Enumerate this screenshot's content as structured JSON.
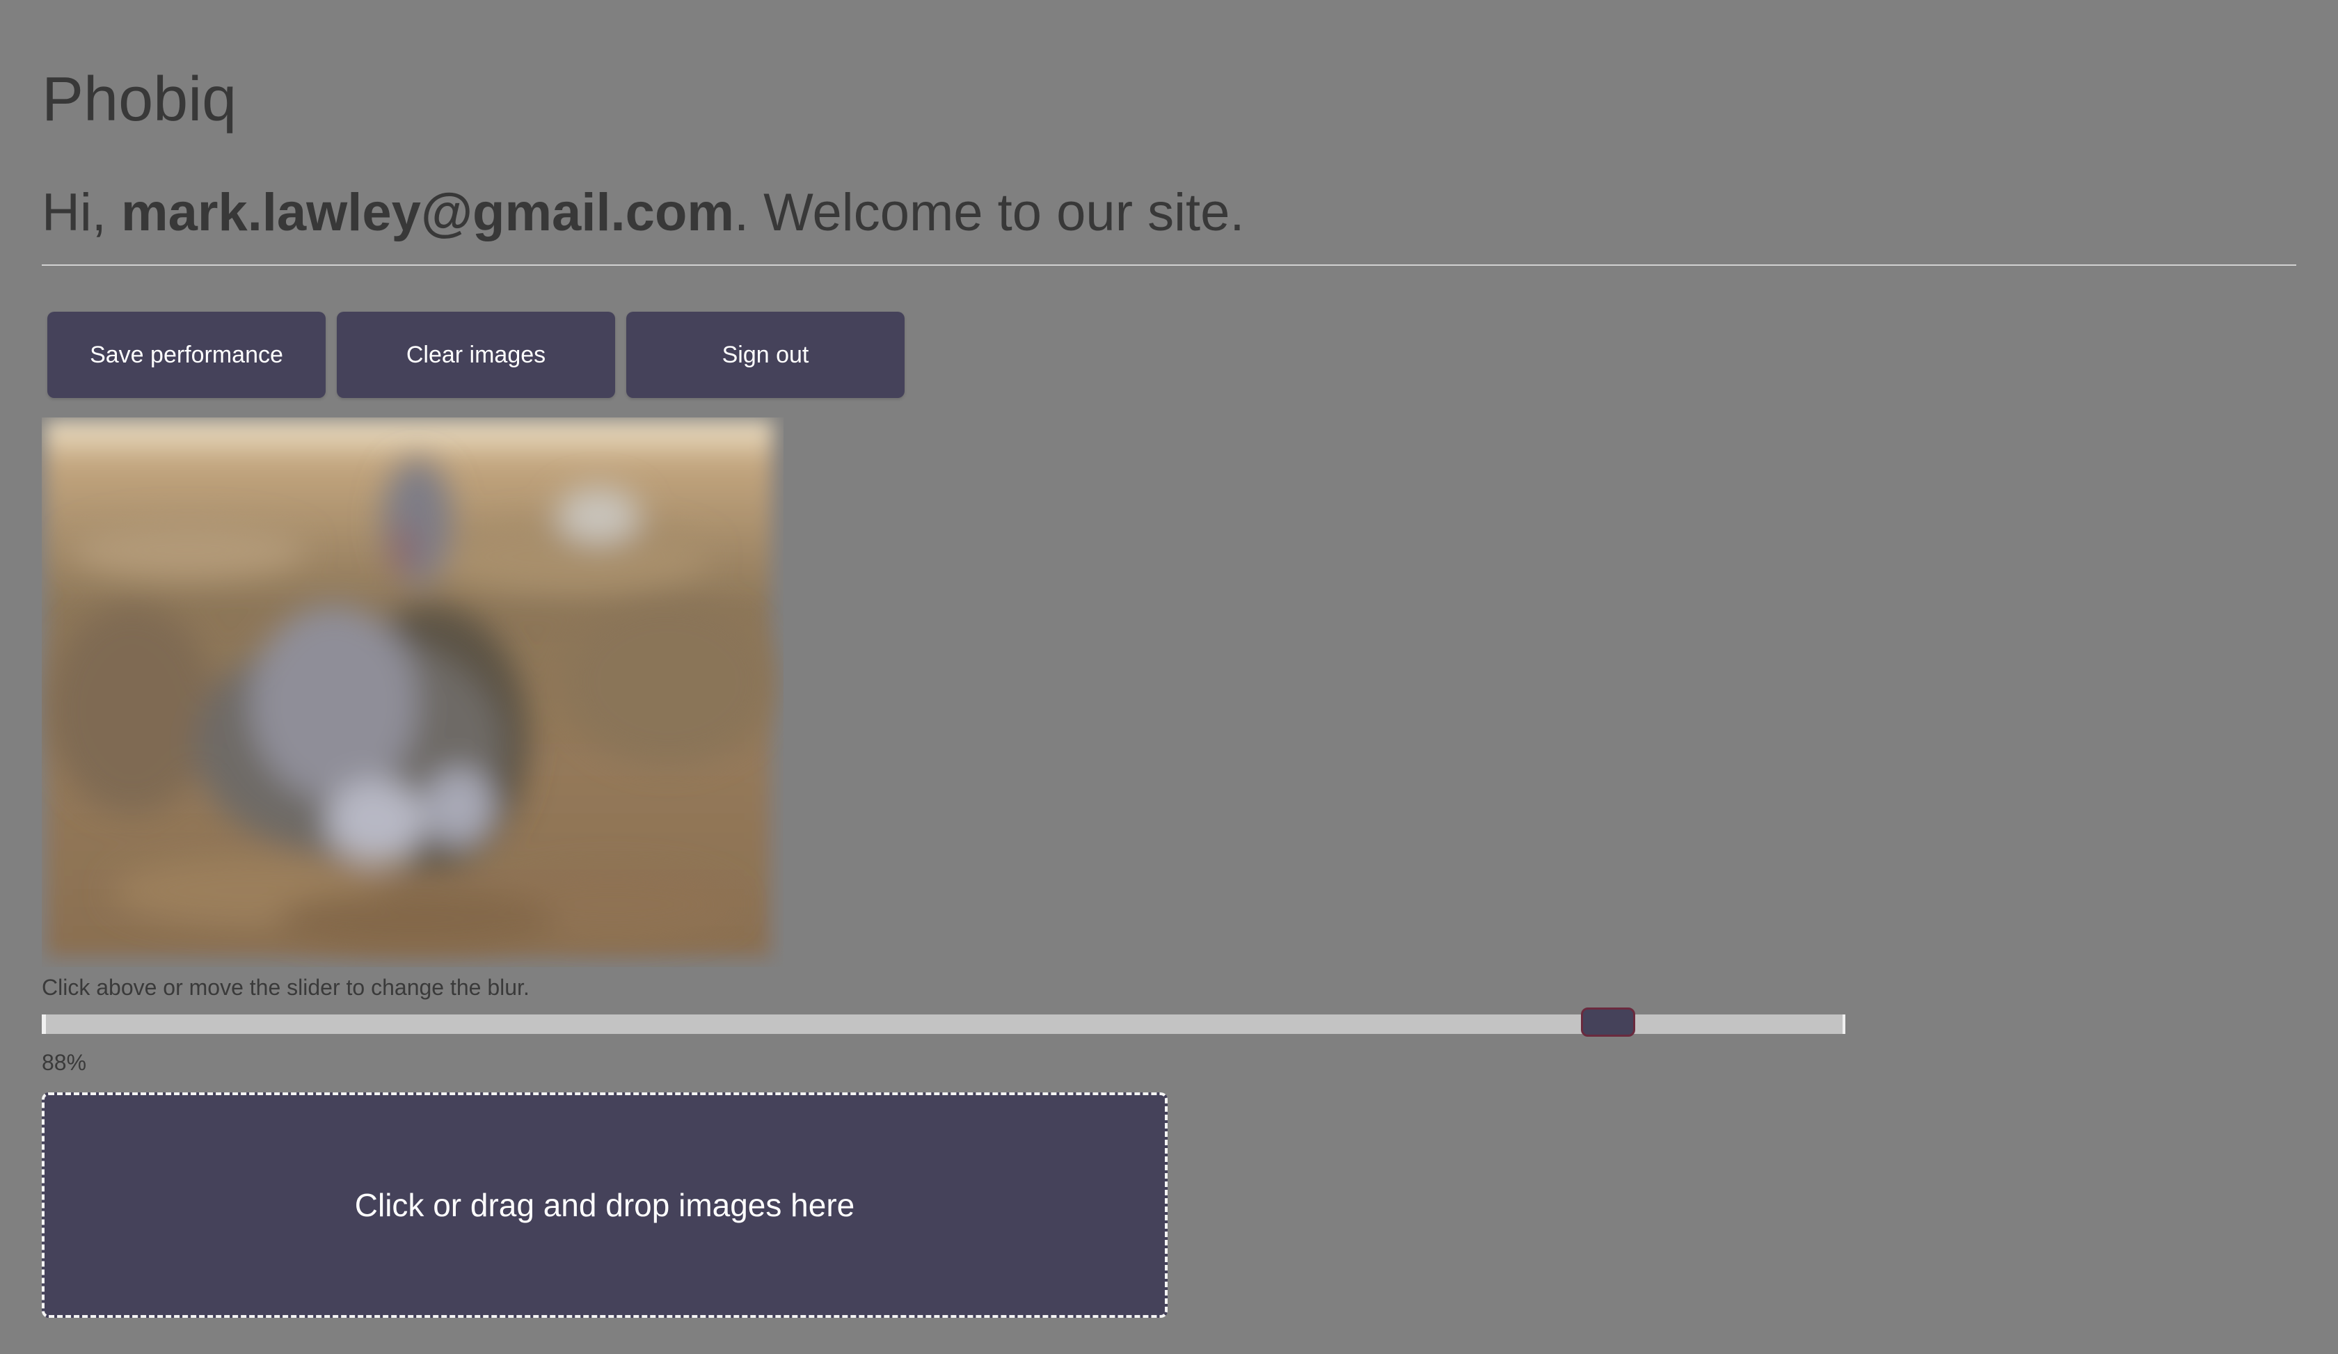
{
  "app": {
    "title": "Phobiq"
  },
  "welcome": {
    "prefix": "Hi, ",
    "email": "mark.lawley@gmail.com",
    "suffix": ". Welcome to our site."
  },
  "toolbar": {
    "save_label": "Save performance",
    "clear_label": "Clear images",
    "signout_label": "Sign out"
  },
  "image": {
    "icon": "blurred-rabbit-photo"
  },
  "blur_control": {
    "hint": "Click above or move the slider to change the blur.",
    "value": 88,
    "value_label": "88%"
  },
  "dropzone": {
    "label": "Click or drag and drop images here"
  },
  "colors": {
    "background": "#808080",
    "accent": "#45425a",
    "text": "#383838"
  }
}
